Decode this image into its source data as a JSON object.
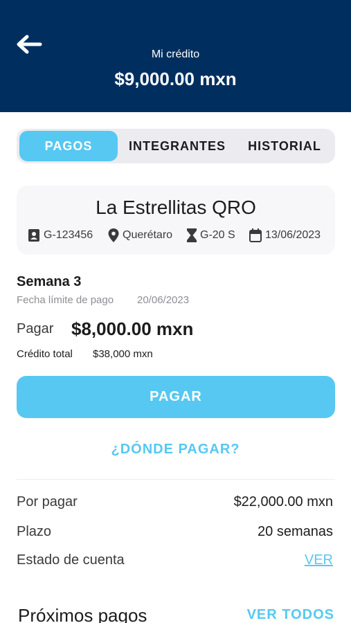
{
  "header": {
    "subtitle": "Mi crédito",
    "amount": "$9,000.00 mxn",
    "background_color": "#002f5f"
  },
  "tabs": [
    {
      "label": "PAGOS",
      "active": true
    },
    {
      "label": "INTEGRANTES",
      "active": false
    },
    {
      "label": "HISTORIAL",
      "active": false
    }
  ],
  "group": {
    "name": "La Estrellitas QRO",
    "meta": [
      {
        "icon": "badge-icon",
        "text": "G-123456"
      },
      {
        "icon": "location-pin-icon",
        "text": "Querétaro"
      },
      {
        "icon": "hourglass-icon",
        "text": "G-20 S"
      },
      {
        "icon": "calendar-icon",
        "text": "13/06/2023"
      }
    ]
  },
  "payment": {
    "week": "Semana 3",
    "due_label": "Fecha límite de pago",
    "due_date": "20/06/2023",
    "pay_label": "Pagar",
    "pay_amount": "$8,000.00 mxn",
    "total_label": "Crédito total",
    "total_amount": "$38,000 mxn"
  },
  "actions": {
    "pay_button": "PAGAR",
    "where_link": "¿DÓNDE PAGAR?",
    "accent_color": "#56c8f2"
  },
  "summary": [
    {
      "label": "Por pagar",
      "value": "$22,000.00 mxn"
    },
    {
      "label": "Plazo",
      "value": "20 semanas"
    },
    {
      "label": "Estado de cuenta",
      "value": "VER"
    }
  ],
  "next_payments": {
    "title": "Próximos pagos",
    "see_all": "VER TODOS"
  }
}
